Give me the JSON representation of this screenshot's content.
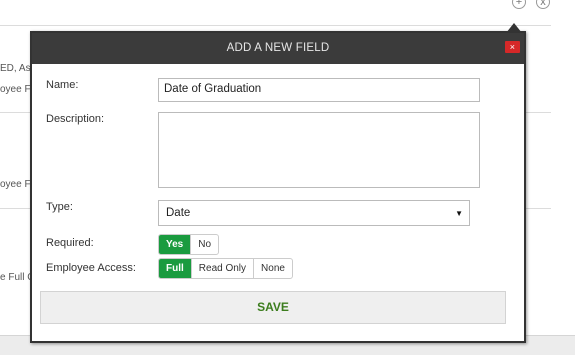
{
  "background": {
    "snippets": [
      "ED, Ass",
      "oyee Fu",
      "oyee Fu",
      "e Full C"
    ],
    "add_icon": "+",
    "close_icon": "x"
  },
  "modal": {
    "title": "ADD A NEW FIELD",
    "close_glyph": "×",
    "name_label": "Name:",
    "name_value": "Date of Graduation",
    "description_label": "Description:",
    "description_value": "",
    "type_label": "Type:",
    "type_value": "Date",
    "type_caret": "▼",
    "required_label": "Required:",
    "required_options": [
      "Yes",
      "No"
    ],
    "required_selected": "Yes",
    "access_label": "Employee Access:",
    "access_options": [
      "Full",
      "Read Only",
      "None"
    ],
    "access_selected": "Full",
    "save_label": "SAVE",
    "colors": {
      "header": "#3b3b3b",
      "accent_green": "#1a9b3f",
      "save_text": "#3c7d1e",
      "close_red": "#d62828"
    }
  }
}
